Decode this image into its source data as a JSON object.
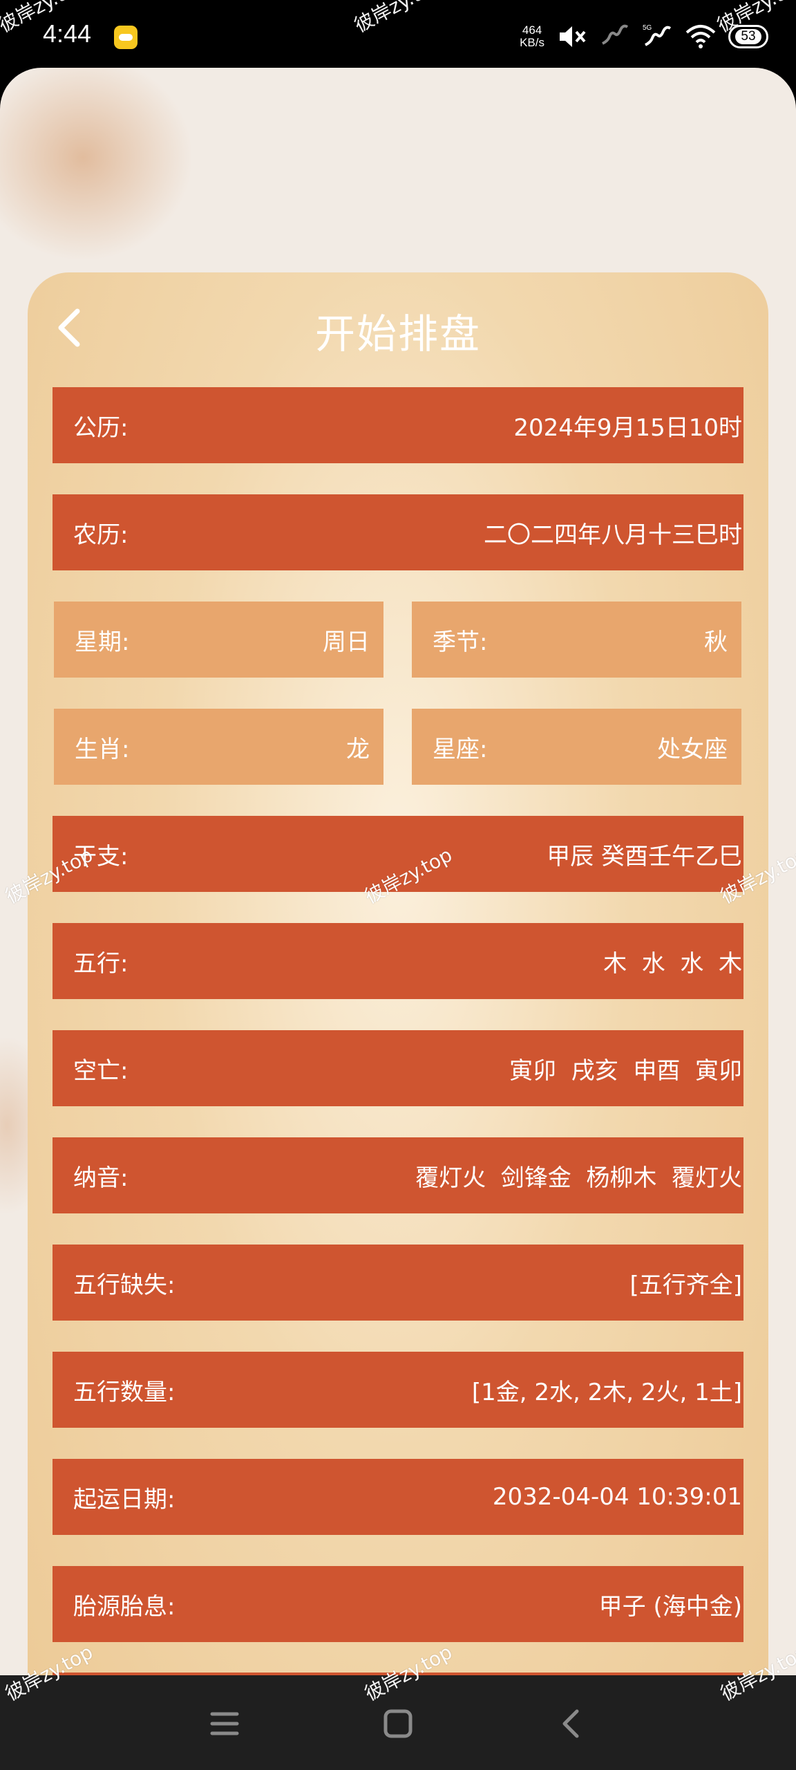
{
  "status_bar": {
    "time": "4:44",
    "speed_value": "464",
    "speed_unit": "KB/s",
    "battery": "53",
    "icons": [
      "notification-app-icon",
      "mute-icon",
      "signal-icon",
      "5g-signal-icon",
      "wifi-icon",
      "battery-icon"
    ]
  },
  "header": {
    "title": "开始排盘",
    "back_icon": "chevron-left-icon"
  },
  "rows": {
    "gongli": {
      "label": "公历:",
      "value": "2024年9月15日10时"
    },
    "nongli": {
      "label": "农历:",
      "value": "二〇二四年八月十三巳时"
    },
    "xingqi": {
      "label": "星期:",
      "value": "周日"
    },
    "jijie": {
      "label": "季节:",
      "value": "秋"
    },
    "shengxiao": {
      "label": "生肖:",
      "value": "龙"
    },
    "xingzuo": {
      "label": "星座:",
      "value": "处女座"
    },
    "ganzhi": {
      "label": "干支:",
      "value": "甲辰 癸酉壬午乙巳"
    },
    "wuxing": {
      "label": "五行:",
      "value": "木  水  水  木"
    },
    "kongwang": {
      "label": "空亡:",
      "value": "寅卯  戌亥  申酉  寅卯"
    },
    "nayin": {
      "label": "纳音:",
      "value": "覆灯火  剑锋金  杨柳木  覆灯火"
    },
    "wuxing_queshi": {
      "label": "五行缺失:",
      "value": "[五行齐全]"
    },
    "wuxing_shuliang": {
      "label": "五行数量:",
      "value": "[1金, 2水, 2木, 2火, 1土]"
    },
    "qiyun": {
      "label": "起运日期:",
      "value": "2032-04-04 10:39:01"
    },
    "taiyuan": {
      "label": "胎源胎息:",
      "value": "甲子 (海中金)"
    }
  },
  "watermark": "彼岸zy.top",
  "colors": {
    "row_dark": "#cf5530",
    "row_light": "#e8a66d",
    "card_bg": "#f2d8ae"
  },
  "nav": {
    "icons": [
      "menu-icon",
      "home-square-icon",
      "back-chevron-icon"
    ]
  }
}
